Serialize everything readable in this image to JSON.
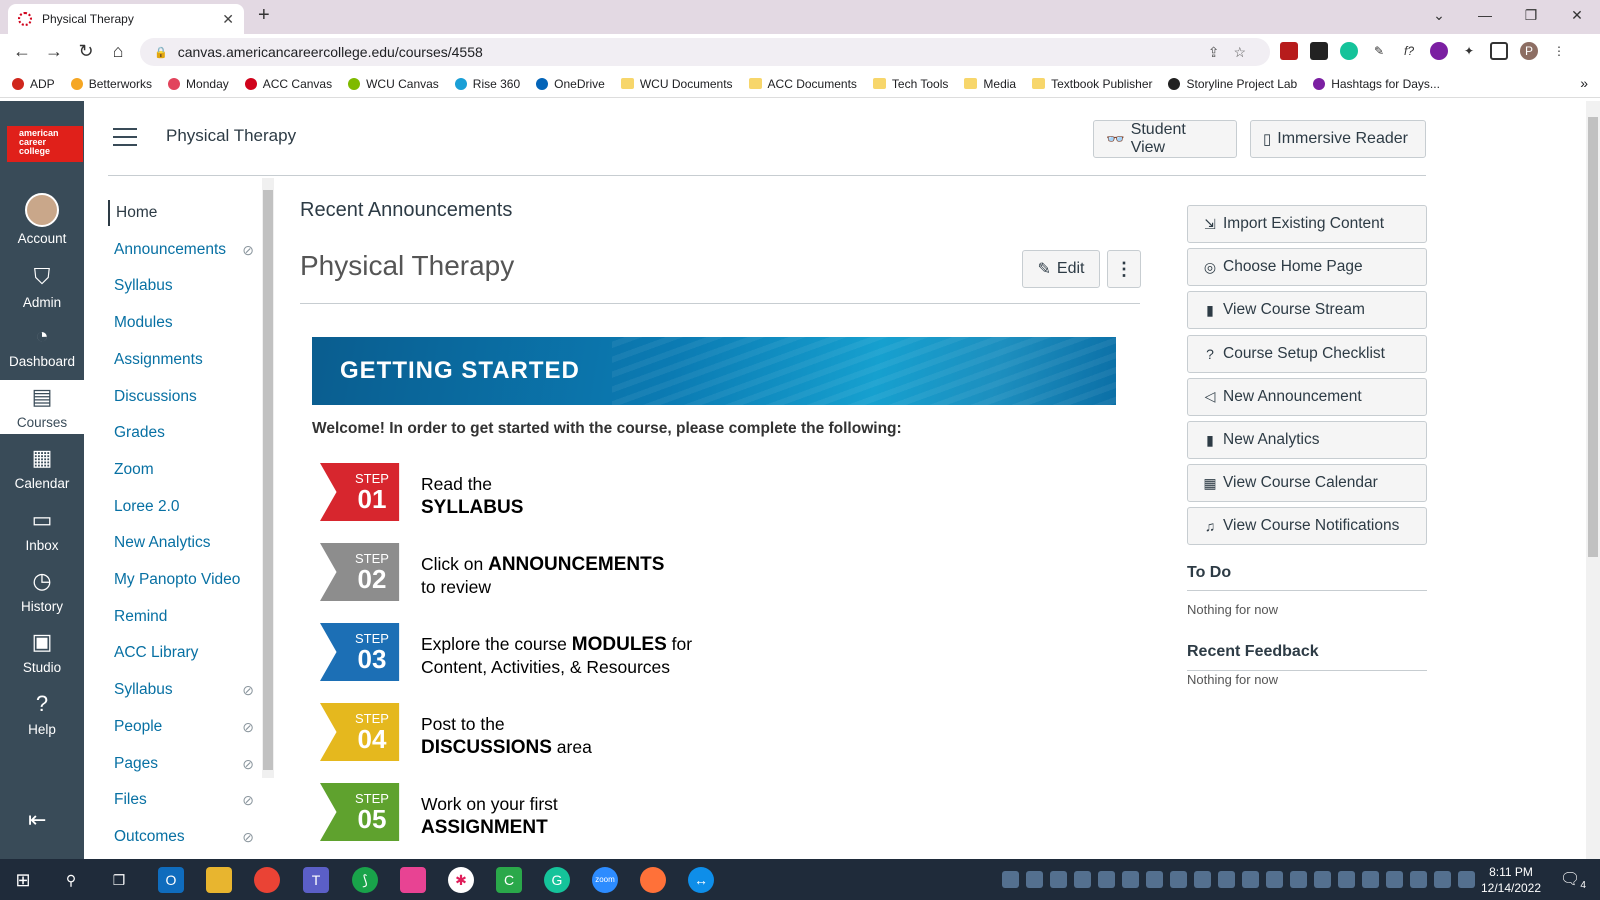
{
  "browser": {
    "tab_title": "Physical Therapy",
    "tab_close": "✕",
    "new_tab": "+",
    "url": "canvas.americancareercollege.edu/courses/4558",
    "window_controls": [
      "⌄",
      "—",
      "❐",
      "✕"
    ],
    "bookmarks": [
      {
        "label": "ADP",
        "icon": "adp-icon",
        "color": "#d0271d"
      },
      {
        "label": "Betterworks",
        "icon": "betterworks-icon",
        "color": "#f5a623"
      },
      {
        "label": "Monday",
        "icon": "monday-icon",
        "color": "#e2445c"
      },
      {
        "label": "ACC Canvas",
        "icon": "canvas-icon",
        "color": "#d0021b"
      },
      {
        "label": "WCU Canvas",
        "icon": "microsoft-icon",
        "color": "#7fba00"
      },
      {
        "label": "Rise 360",
        "icon": "rise-icon",
        "color": "#1a9fd6"
      },
      {
        "label": "OneDrive",
        "icon": "onedrive-icon",
        "color": "#0364b8"
      },
      {
        "label": "WCU Documents",
        "icon": "folder-icon",
        "color": "#f7d66b"
      },
      {
        "label": "ACC Documents",
        "icon": "folder-icon",
        "color": "#f7d66b"
      },
      {
        "label": "Tech Tools",
        "icon": "folder-icon",
        "color": "#f7d66b"
      },
      {
        "label": "Media",
        "icon": "folder-icon",
        "color": "#f7d66b"
      },
      {
        "label": "Textbook Publisher",
        "icon": "folder-icon",
        "color": "#f7d66b"
      },
      {
        "label": "Storyline Project Lab",
        "icon": "storyline-icon",
        "color": "#222222"
      },
      {
        "label": "Hashtags for Days...",
        "icon": "hashtag-icon",
        "color": "#7b1fa2"
      }
    ],
    "bookmarks_more": "»"
  },
  "global_nav": {
    "logo_lines": [
      "american",
      "career",
      "college"
    ],
    "items": [
      {
        "label": "Account",
        "icon": "avatar-icon"
      },
      {
        "label": "Admin",
        "icon": "admin-shield-icon",
        "glyph": "⛉"
      },
      {
        "label": "Dashboard",
        "icon": "dashboard-gauge-icon",
        "glyph": "◔"
      },
      {
        "label": "Courses",
        "icon": "courses-book-icon",
        "glyph": "▤"
      },
      {
        "label": "Calendar",
        "icon": "calendar-icon",
        "glyph": "▦"
      },
      {
        "label": "Inbox",
        "icon": "inbox-icon",
        "glyph": "▭"
      },
      {
        "label": "History",
        "icon": "history-clock-icon",
        "glyph": "◷"
      },
      {
        "label": "Studio",
        "icon": "studio-icon",
        "glyph": "▣"
      },
      {
        "label": "Help",
        "icon": "help-icon",
        "glyph": "?"
      }
    ],
    "collapse_glyph": "⇤"
  },
  "header": {
    "breadcrumb": "Physical Therapy",
    "student_view": "Student View",
    "immersive_reader": "Immersive Reader"
  },
  "course_nav": {
    "items": [
      {
        "label": "Home",
        "active": true,
        "hidden": false
      },
      {
        "label": "Announcements",
        "active": false,
        "hidden": true
      },
      {
        "label": "Syllabus",
        "active": false,
        "hidden": false
      },
      {
        "label": "Modules",
        "active": false,
        "hidden": false
      },
      {
        "label": "Assignments",
        "active": false,
        "hidden": false
      },
      {
        "label": "Discussions",
        "active": false,
        "hidden": false
      },
      {
        "label": "Grades",
        "active": false,
        "hidden": false
      },
      {
        "label": "Zoom",
        "active": false,
        "hidden": false
      },
      {
        "label": "Loree 2.0",
        "active": false,
        "hidden": false
      },
      {
        "label": "New Analytics",
        "active": false,
        "hidden": false
      },
      {
        "label": "My Panopto Video",
        "active": false,
        "hidden": false
      },
      {
        "label": "Remind",
        "active": false,
        "hidden": false
      },
      {
        "label": "ACC Library",
        "active": false,
        "hidden": false
      },
      {
        "label": "Syllabus",
        "active": false,
        "hidden": true
      },
      {
        "label": "People",
        "active": false,
        "hidden": true
      },
      {
        "label": "Pages",
        "active": false,
        "hidden": true
      },
      {
        "label": "Files",
        "active": false,
        "hidden": true
      },
      {
        "label": "Outcomes",
        "active": false,
        "hidden": true
      }
    ]
  },
  "main": {
    "recent_announcements": "Recent Announcements",
    "page_title": "Physical Therapy",
    "edit_label": "Edit",
    "more_glyph": "⋮",
    "banner": "GETTING STARTED",
    "welcome": "Welcome! In order to get started with the course, please complete the following:",
    "step_word": "STEP",
    "steps": [
      {
        "num": "01",
        "color": "#d7262e",
        "line1_pre": "Read the",
        "line1_bold": "",
        "line1_post": "",
        "line2_pre": "",
        "line2_bold": "SYLLABUS",
        "line2_post": ""
      },
      {
        "num": "02",
        "color": "#8d8d8d",
        "line1_pre": "Click on ",
        "line1_bold": "ANNOUNCEMENTS",
        "line1_post": "",
        "line2_pre": "to review",
        "line2_bold": "",
        "line2_post": ""
      },
      {
        "num": "03",
        "color": "#1c6fb5",
        "line1_pre": "Explore the course ",
        "line1_bold": "MODULES",
        "line1_post": " for",
        "line2_pre": "Content, Activities, & Resources",
        "line2_bold": "",
        "line2_post": ""
      },
      {
        "num": "04",
        "color": "#e5b81e",
        "line1_pre": "Post to the",
        "line1_bold": "",
        "line1_post": "",
        "line2_pre": "",
        "line2_bold": "DISCUSSIONS",
        "line2_post": " area"
      },
      {
        "num": "05",
        "color": "#5fa22e",
        "line1_pre": "Work on your first",
        "line1_bold": "",
        "line1_post": "",
        "line2_pre": "",
        "line2_bold": "ASSIGNMENT",
        "line2_post": ""
      }
    ]
  },
  "sidebar": {
    "buttons": [
      {
        "label": "Import Existing Content",
        "icon": "import-icon",
        "glyph": "⇲"
      },
      {
        "label": "Choose Home Page",
        "icon": "home-target-icon",
        "glyph": "◎"
      },
      {
        "label": "View Course Stream",
        "icon": "bar-chart-icon",
        "glyph": "▮"
      },
      {
        "label": "Course Setup Checklist",
        "icon": "question-circle-icon",
        "glyph": "?"
      },
      {
        "label": "New Announcement",
        "icon": "megaphone-icon",
        "glyph": "◁"
      },
      {
        "label": "New Analytics",
        "icon": "analytics-icon",
        "glyph": "▮"
      },
      {
        "label": "View Course Calendar",
        "icon": "calendar-icon",
        "glyph": "▦"
      },
      {
        "label": "View Course Notifications",
        "icon": "bell-icon",
        "glyph": "♫"
      }
    ],
    "todo_title": "To Do",
    "todo_empty": "Nothing for now",
    "feedback_title": "Recent Feedback",
    "feedback_empty": "Nothing for now"
  },
  "taskbar": {
    "time": "8:11 PM",
    "date": "12/14/2022",
    "notification_count": "4"
  }
}
